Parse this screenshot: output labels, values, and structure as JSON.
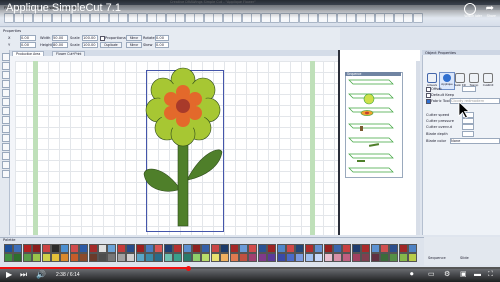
{
  "video": {
    "title": "Applique SimpleCut 7.1",
    "watch_later": "Watch later",
    "share": "Share",
    "time": "2:38 / 6:14",
    "progress_fraction": 0.376
  },
  "app": {
    "window_title": "Creative DRAWings Simple Cut - \"Applique Flower\"",
    "menus": [
      "File",
      "Edit",
      "View",
      "Tools",
      "Design",
      "Window",
      "Help"
    ],
    "property_bar_label": "Properties",
    "fields": {
      "x": "X",
      "x_val": "0.00",
      "w": "Width",
      "w_val": "50.00",
      "scale_x": "Scale",
      "scale_x_val": "100.00",
      "proportional": "Proportional",
      "mirror": "Mirror",
      "rotate": "Rotate",
      "rotate_val": "0.00",
      "y": "Y",
      "y_val": "0.00",
      "h": "Height",
      "h_val": "80.00",
      "scale_y": "Scale",
      "scale_y_val": "100.00",
      "duplicate": "Duplicate",
      "mirror_v": "Mirror",
      "skew": "Skew",
      "skew_val": "0.00"
    },
    "tabs": [
      "Production Area",
      "Flower Cut+Print"
    ],
    "sequence_title": "Sequence"
  },
  "properties": {
    "title": "Object Properties",
    "tabs": [
      {
        "label": "Artwork",
        "icon": "artwork-icon",
        "color": "#4466aa"
      },
      {
        "label": "Applique",
        "icon": "applique-icon",
        "color": "#2f6fd0"
      },
      {
        "label": "Satin Fill",
        "icon": "satin-fill-icon",
        "color": "#777777"
      },
      {
        "label": "Stamp",
        "icon": "stamp-icon",
        "color": "#777777"
      },
      {
        "label": "Cut&Fill",
        "icon": "cut-fill-icon",
        "color": "#777777"
      }
    ],
    "offset_label": "Offset",
    "default_keep_label": "Default Keep",
    "fabric_tool_label": "Fabric Tool",
    "fabric_value": "Cloudy redmodern",
    "cutter_speed": "Cutter speed",
    "cutter_pressure": "Cutter pressure",
    "cutter_overcut": "Cutter overcut",
    "blade_depth": "Blade depth",
    "blade_color": "Blade color",
    "blade_color_value": "None",
    "status_left": "Sequence",
    "status_right": "Slide"
  },
  "palette": {
    "label": "Palette",
    "row1": [
      "#1d4f9a",
      "#3d6eb8",
      "#b32222",
      "#8a1d1d",
      "#cc4444",
      "#2b2b2b",
      "#4c8fd0",
      "#d04b4b",
      "#2c5aa6",
      "#a32a2a",
      "#e0e0e0",
      "#6aa3d8",
      "#c43a3a",
      "#264c8a",
      "#9c1f1f",
      "#4a7cc0",
      "#d85555",
      "#1f3f73",
      "#b53030",
      "#5a8ed0",
      "#8e2020",
      "#345fa8",
      "#c94545",
      "#1b3a6b",
      "#a52828",
      "#6b9bd8",
      "#d24c4c",
      "#2a5294",
      "#9b2424",
      "#4f86c9",
      "#cf4848",
      "#234777",
      "#b02c2c",
      "#628fcf",
      "#962020",
      "#3a66ad",
      "#c84040",
      "#1e3c6e",
      "#aa2a2a",
      "#5c92d2",
      "#d05050",
      "#2c4f8e",
      "#a02626",
      "#4e82c4"
    ],
    "row2": [
      "#3f8f3f",
      "#2d6e2d",
      "#5a9e4a",
      "#9ac44a",
      "#cfd34a",
      "#e5c23a",
      "#d9892d",
      "#c45c2a",
      "#8b4a2a",
      "#6a3a2a",
      "#4d4d4d",
      "#777777",
      "#a0a0a0",
      "#cfcfcf",
      "#59a6c8",
      "#3a8aa8",
      "#2a6b88",
      "#6cc0b0",
      "#3aa08a",
      "#2a7a6a",
      "#8fcf6a",
      "#b8dc6a",
      "#e8e070",
      "#f0b060",
      "#e07a50",
      "#c05040",
      "#a04070",
      "#803a8a",
      "#5a3a9a",
      "#3a4aa8",
      "#4a6ac8",
      "#7a9ae0",
      "#a0c0f0",
      "#c8d8f8",
      "#e8c0d0",
      "#d890a8",
      "#c06080",
      "#a04060",
      "#804050",
      "#603040",
      "#3b6b3b",
      "#558f45",
      "#86b84a",
      "#b9cc48"
    ]
  }
}
